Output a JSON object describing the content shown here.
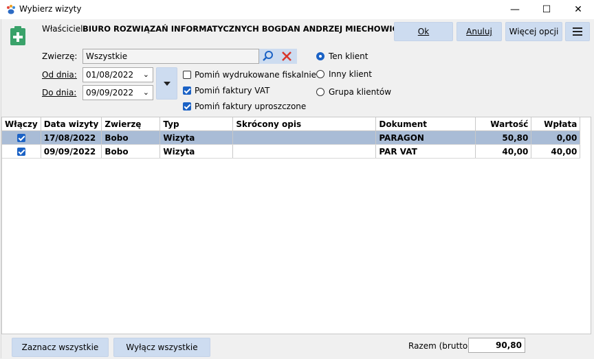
{
  "window": {
    "title": "Wybierz wizyty",
    "minimize_glyph": "—",
    "maximize_glyph": "☐",
    "close_glyph": "✕"
  },
  "owner": {
    "label": "Właściciel:",
    "value": "BIURO ROZWIĄZAŃ INFORMATYCZNYCH BOGDAN ANDRZEJ MIECHOWICZ"
  },
  "buttons": {
    "ok": "Ok",
    "cancel": "Anuluj",
    "more_options": "Więcej opcji",
    "menu_icon": "hamburger-menu-icon"
  },
  "filters": {
    "animal_label": "Zwierzę:",
    "animal_value": "Wszystkie",
    "from_label": "Od dnia:",
    "from_value": "01/08/2022",
    "to_label": "Do dnia:",
    "to_value": "09/09/2022",
    "checkboxes": [
      {
        "label": "Pomiń wydrukowane fiskalnie",
        "checked": false
      },
      {
        "label": "Pomiń faktury VAT",
        "checked": true
      },
      {
        "label": "Pomiń faktury uproszczone",
        "checked": true
      }
    ],
    "radios": [
      {
        "label": "Ten klient",
        "checked": true
      },
      {
        "label": "Inny klient",
        "checked": false
      },
      {
        "label": "Grupa klientów",
        "checked": false
      }
    ]
  },
  "table": {
    "columns": [
      "Włączy",
      "Data wizyty",
      "Zwierzę",
      "Typ",
      "Skrócony opis",
      "Dokument",
      "Wartość",
      "Wpłata"
    ],
    "rows": [
      {
        "included": true,
        "date": "17/08/2022",
        "animal": "Bobo",
        "type": "Wizyta",
        "description": "",
        "document": "PARAGON",
        "value": "50,80",
        "payment": "0,00",
        "selected": true
      },
      {
        "included": true,
        "date": "09/09/2022",
        "animal": "Bobo",
        "type": "Wizyta",
        "description": "",
        "document": "PAR VAT",
        "value": "40,00",
        "payment": "40,00",
        "selected": false
      }
    ]
  },
  "footer": {
    "select_all": "Zaznacz wszystkie",
    "deselect_all": "Wyłącz wszystkie",
    "total_label": "Razem (brutto):",
    "total_value": "90,80"
  },
  "colors": {
    "accent": "#1b62c5",
    "button_bg": "#cddcf0",
    "selected_row": "#a9bcd6",
    "clear_icon": "#d9362b",
    "add_icon": "#3aa26a"
  }
}
